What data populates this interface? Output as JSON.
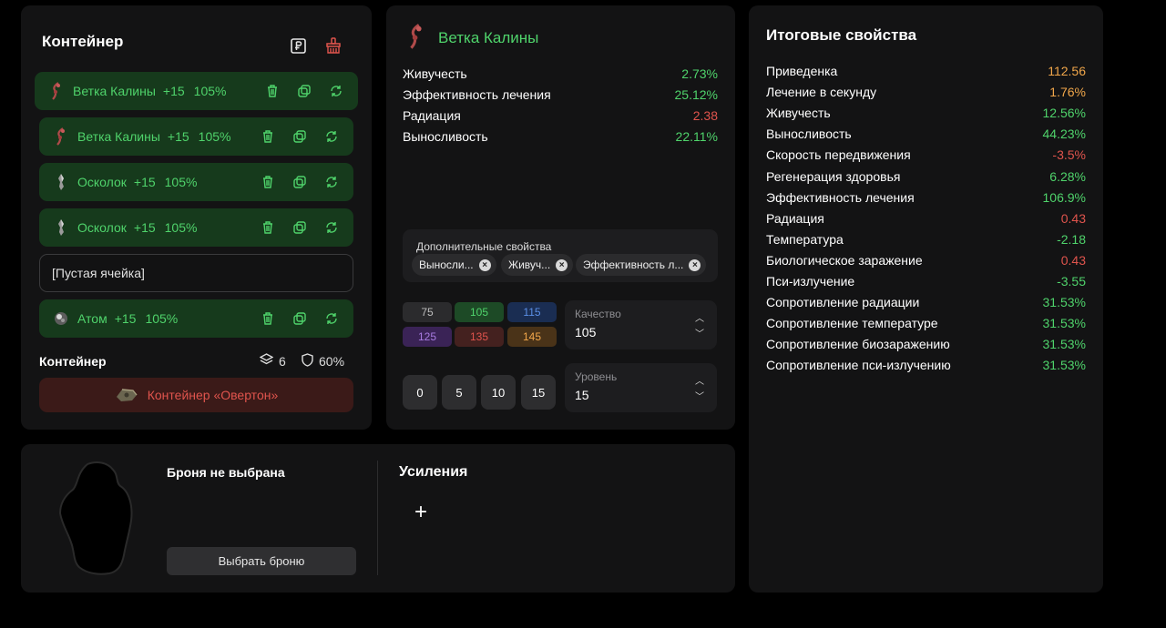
{
  "container": {
    "title": "Контейнер",
    "items": [
      {
        "name": "Ветка Калины",
        "level": "+15",
        "quality": "105%",
        "icon": "viburnum-branch-icon"
      },
      {
        "name": "Ветка Калины",
        "level": "+15",
        "quality": "105%",
        "icon": "viburnum-branch-icon"
      },
      {
        "name": "Осколок",
        "level": "+15",
        "quality": "105%",
        "icon": "shard-icon"
      },
      {
        "name": "Осколок",
        "level": "+15",
        "quality": "105%",
        "icon": "shard-icon"
      }
    ],
    "empty_slot": "[Пустая ячейка]",
    "last_item": {
      "name": "Атом",
      "level": "+15",
      "quality": "105%",
      "icon": "atom-icon"
    },
    "footer_label": "Контейнер",
    "capacity": "6",
    "protection": "60%",
    "container_button": "Контейнер «Овертон»"
  },
  "detail": {
    "title": "Ветка Калины",
    "props": [
      {
        "name": "Живучесть",
        "value": "2.73%"
      },
      {
        "name": "Эффективность лечения",
        "value": "25.12%"
      },
      {
        "name": "Радиация",
        "value": "2.38"
      },
      {
        "name": "Выносливость",
        "value": "22.11%"
      }
    ],
    "extra_title": "Дополнительные свойства",
    "chips": [
      "Выносли...",
      "Живуч...",
      "Эффективность л..."
    ],
    "quality_options": [
      "75",
      "105",
      "115",
      "125",
      "135",
      "145"
    ],
    "quality_label": "Качество",
    "quality_value": "105",
    "level_options": [
      "0",
      "5",
      "10",
      "15"
    ],
    "level_label": "Уровень",
    "level_value": "15"
  },
  "totals": {
    "title": "Итоговые свойства",
    "rows": [
      {
        "name": "Приведенка",
        "value": "112.56"
      },
      {
        "name": "Лечение в секунду",
        "value": "1.76%"
      },
      {
        "name": "Живучесть",
        "value": "12.56%"
      },
      {
        "name": "Выносливость",
        "value": "44.23%"
      },
      {
        "name": "Скорость передвижения",
        "value": "-3.5%"
      },
      {
        "name": "Регенерация здоровья",
        "value": "6.28%"
      },
      {
        "name": "Эффективность лечения",
        "value": "106.9%"
      },
      {
        "name": "Радиация",
        "value": "0.43"
      },
      {
        "name": "Температура",
        "value": "-2.18"
      },
      {
        "name": "Биологическое заражение",
        "value": "0.43"
      },
      {
        "name": "Пси-излучение",
        "value": "-3.55"
      },
      {
        "name": "Сопротивление радиации",
        "value": "31.53%"
      },
      {
        "name": "Сопротивление температуре",
        "value": "31.53%"
      },
      {
        "name": "Сопротивление биозаражению",
        "value": "31.53%"
      },
      {
        "name": "Сопротивление пси-излучению",
        "value": "31.53%"
      }
    ]
  },
  "armor": {
    "title": "Броня не выбрана",
    "select_button": "Выбрать броню",
    "boosts_title": "Усиления",
    "add_symbol": "+"
  },
  "colors": {
    "positive": "#4fd36b",
    "negative": "#e0544d",
    "warning": "#f0a64a",
    "panel": "#131314",
    "item_bg": "#163a1c"
  }
}
